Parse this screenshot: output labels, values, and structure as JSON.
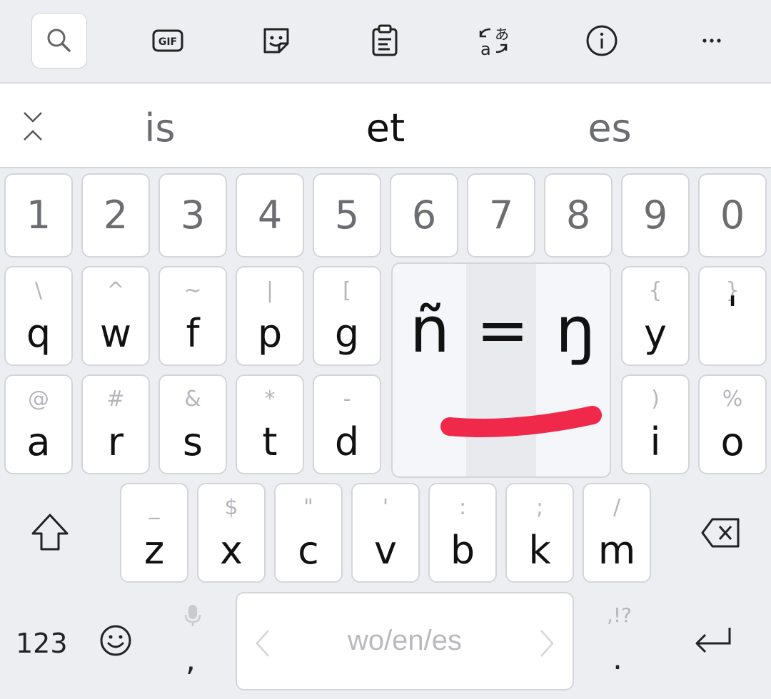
{
  "toolbar": {
    "items": [
      {
        "name": "search-icon"
      },
      {
        "name": "gif-icon",
        "label": "GIF"
      },
      {
        "name": "sticker-icon"
      },
      {
        "name": "clipboard-icon"
      },
      {
        "name": "translate-icon"
      },
      {
        "name": "info-icon"
      },
      {
        "name": "more-icon",
        "label": "···"
      }
    ]
  },
  "suggestions": {
    "left": "is",
    "center": "et",
    "right": "es"
  },
  "number_row": [
    "1",
    "2",
    "3",
    "4",
    "5",
    "6",
    "7",
    "8",
    "9",
    "0"
  ],
  "row1": {
    "q": {
      "main": "q",
      "hint": "\\"
    },
    "w": {
      "main": "w",
      "hint": "^"
    },
    "f": {
      "main": "f",
      "hint": "~"
    },
    "p": {
      "main": "p",
      "hint": "|"
    },
    "g": {
      "main": "g",
      "hint": "["
    },
    "y": {
      "main": "y",
      "hint": "{"
    },
    "apos": {
      "main": "'",
      "hint": "}"
    }
  },
  "row2": {
    "a": {
      "main": "a",
      "hint": "@"
    },
    "r": {
      "main": "r",
      "hint": "#"
    },
    "s": {
      "main": "s",
      "hint": "&"
    },
    "t": {
      "main": "t",
      "hint": "*"
    },
    "d": {
      "main": "d",
      "hint": "-"
    },
    "i": {
      "main": "i",
      "hint": ")"
    },
    "o": {
      "main": "o",
      "hint": "%"
    }
  },
  "row3": {
    "z": {
      "main": "z",
      "hint": "_"
    },
    "x": {
      "main": "x",
      "hint": "$"
    },
    "c": {
      "main": "c",
      "hint": "\""
    },
    "v": {
      "main": "v",
      "hint": "'"
    },
    "b": {
      "main": "b",
      "hint": ":"
    },
    "k": {
      "main": "k",
      "hint": ";"
    },
    "m": {
      "main": "m",
      "hint": "/"
    }
  },
  "popup": {
    "left": "ñ",
    "center": "=",
    "right": "ŋ",
    "stroke_color": "#f0284a"
  },
  "bottom": {
    "numbers_label": "123",
    "comma": ",",
    "space_label": "wo/en/es",
    "period": ".",
    "period_hint": ",!?"
  },
  "colors": {
    "background": "#edeef2",
    "key": "#ffffff",
    "hint_text": "#b4b6bb",
    "accent_stroke": "#f0284a"
  }
}
